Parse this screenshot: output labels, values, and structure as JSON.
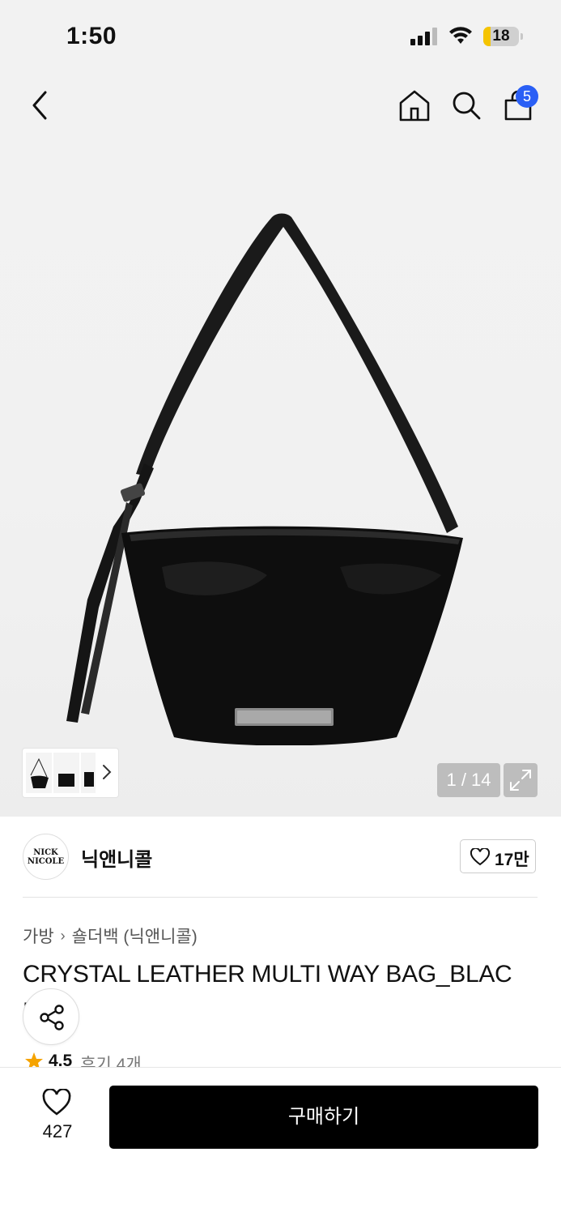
{
  "status_bar": {
    "time": "1:50",
    "battery": "18",
    "icons": [
      "cellular-signal-icon",
      "wifi-icon",
      "battery-icon"
    ]
  },
  "nav": {
    "icons": [
      "back-arrow-icon",
      "home-icon",
      "search-icon",
      "shopping-bag-icon"
    ],
    "cart_count": "5"
  },
  "gallery": {
    "counter": "1 / 14",
    "icons": [
      "chevron-right-icon",
      "expand-icon"
    ]
  },
  "brand": {
    "logo_text": "NICK NICOLE",
    "name": "닉앤니콜",
    "favorite_count": "17만"
  },
  "breadcrumb": {
    "category": "가방",
    "subcategory": "숄더백 (닉앤니콜)"
  },
  "product": {
    "title": "CRYSTAL LEATHER MULTI WAY BAG_BLAC",
    "title_wrap": "K",
    "rating": "4.5",
    "reviews": "후기 4개"
  },
  "bottom_bar": {
    "like_count": "427",
    "buy_label": "구매하기"
  },
  "colors": {
    "accent_badge": "#2a5ff5",
    "star": "#f5a300",
    "buy_button": "#000000",
    "battery_fill": "#f5c400"
  }
}
